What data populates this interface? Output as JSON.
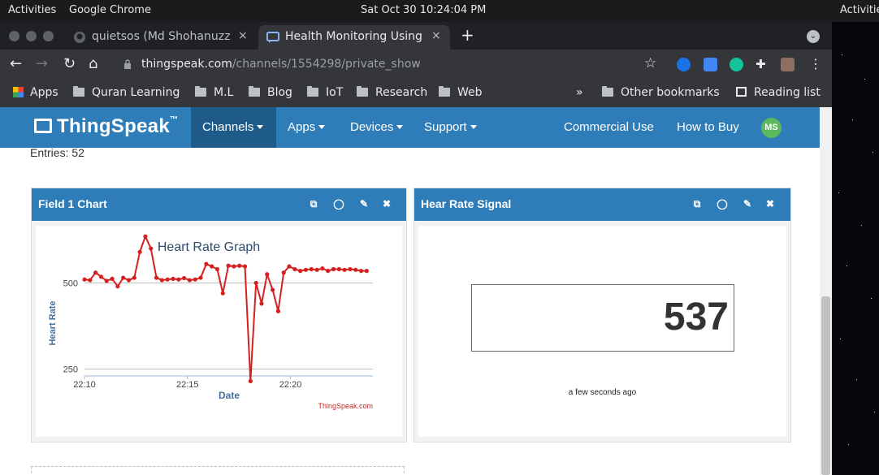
{
  "os_bar": {
    "activities": "Activities",
    "app_name": "Google Chrome",
    "clock": "Sat Oct 30  10:24:04 PM",
    "activities_right": "Activitie"
  },
  "tabs": [
    {
      "title": "quietsos (Md Shohanuzzama",
      "icon": "github-icon",
      "close": "×"
    },
    {
      "title": "Health Monitoring Using Io",
      "icon": "thingspeak-icon",
      "close": "×"
    }
  ],
  "toolbar": {
    "url_host": "thingspeak.com",
    "url_path": "/channels/1554298/private_show"
  },
  "bookmarks": {
    "apps": "Apps",
    "items": [
      "Quran Learning",
      "M.L",
      "Blog",
      "IoT",
      "Research",
      "Web"
    ],
    "overflow": "»",
    "other": "Other bookmarks",
    "reading_list": "Reading list"
  },
  "ts_nav": {
    "logo": "ThingSpeak",
    "tm": "™",
    "items": [
      "Channels",
      "Apps",
      "Devices",
      "Support"
    ],
    "right_items": [
      "Commercial Use",
      "How to Buy"
    ],
    "avatar": "MS"
  },
  "channel": {
    "entries": "Entries: 52"
  },
  "widgets": {
    "chart": {
      "title": "Field 1 Chart"
    },
    "signal": {
      "title": "Hear Rate Signal",
      "value": "537",
      "time": "a few seconds ago"
    }
  },
  "chart_data": {
    "type": "line",
    "title": "Heart Rate Graph",
    "xlabel": "Date",
    "ylabel": "Heart Rate",
    "credit": "ThingSpeak.com",
    "x_ticks": [
      "22:10",
      "22:15",
      "22:20"
    ],
    "y_ticks": [
      250,
      500
    ],
    "xlim": [
      "22:10",
      "22:24"
    ],
    "ylim": [
      230,
      560
    ],
    "color": "#d62020",
    "series": [
      {
        "values": [
          510,
          508,
          530,
          518,
          506,
          512,
          490,
          515,
          508,
          515,
          590,
          635,
          600,
          515,
          508,
          510,
          512,
          510,
          514,
          508,
          510,
          515,
          555,
          548,
          540,
          470,
          550,
          548,
          550,
          548,
          215,
          500,
          440,
          525,
          480,
          418,
          530,
          548,
          540,
          535,
          538,
          540,
          538,
          542,
          535,
          540,
          540,
          538,
          540,
          538,
          535,
          535
        ]
      }
    ]
  }
}
